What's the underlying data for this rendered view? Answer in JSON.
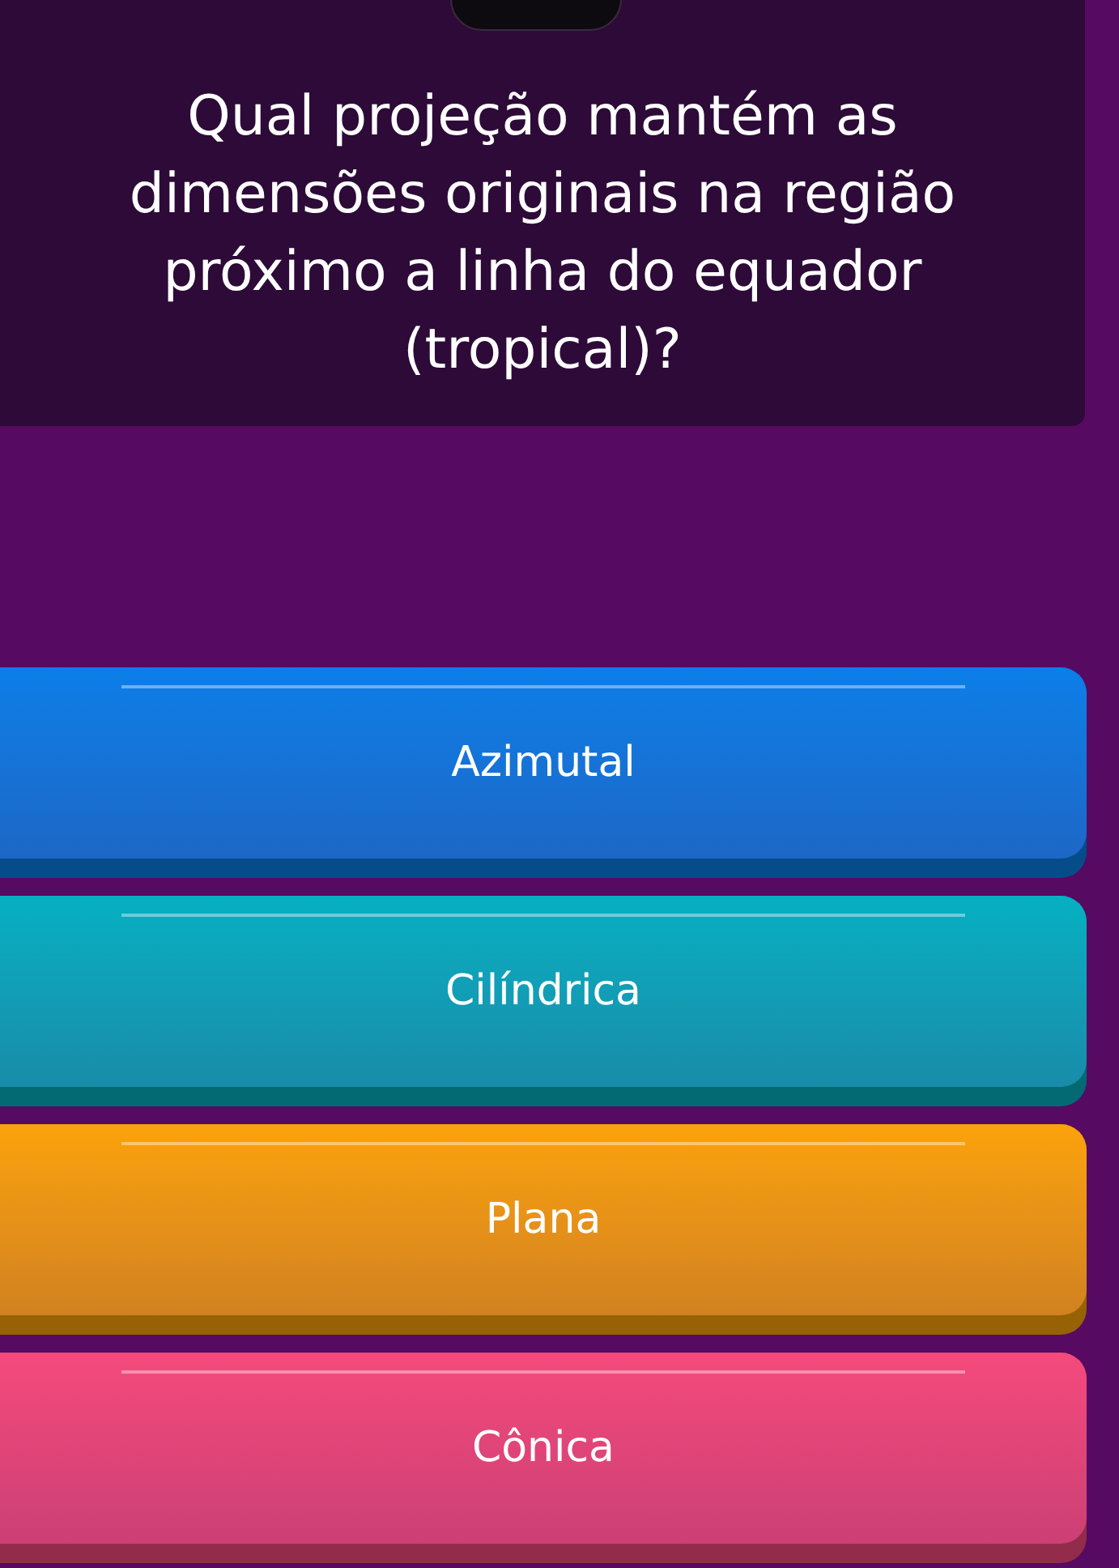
{
  "question": {
    "text": "Qual projeção mantém as dimensões originais na região próximo a linha do equador (tropical)?"
  },
  "options": [
    {
      "label": "Azimutal",
      "color": "#0a7fe8"
    },
    {
      "label": "Cilíndrica",
      "color": "#05b0c2"
    },
    {
      "label": "Plana",
      "color": "#fca20a"
    },
    {
      "label": "Cônica",
      "color": "#f54a7c"
    }
  ]
}
